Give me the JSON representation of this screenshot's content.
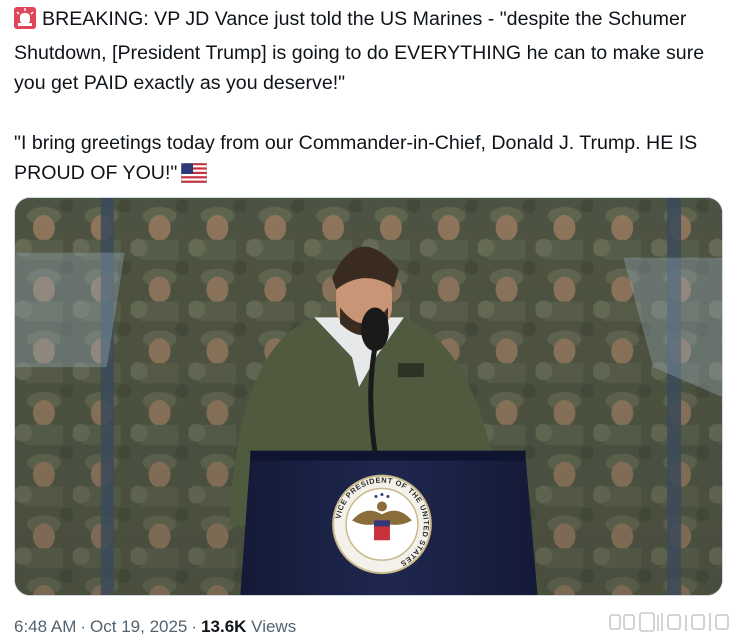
{
  "tweet": {
    "line1": "BREAKING: VP JD Vance just told the US Marines -  \"despite the Schumer Shutdown, [President Trump] is going to do EVERYTHING he can to make sure you get PAID exactly as you deserve!\"",
    "line2": "\"I bring greetings today from our Commander-in-Chief, Donald J. Trump. HE IS PROUD OF YOU!\"",
    "siren_emoji": "police-car-light-icon",
    "flag_emoji": "us-flag-icon"
  },
  "media": {
    "seal_text": "VICE PRESIDENT OF THE UNITED STATES"
  },
  "meta": {
    "time": "6:48 AM",
    "separator": "·",
    "date": "Oct 19, 2025",
    "views_count": "13.6K",
    "views_label": "Views"
  },
  "colors": {
    "text": "#0f1419",
    "secondary": "#536471",
    "border": "#cfd9de",
    "podium": "#1a2140"
  }
}
